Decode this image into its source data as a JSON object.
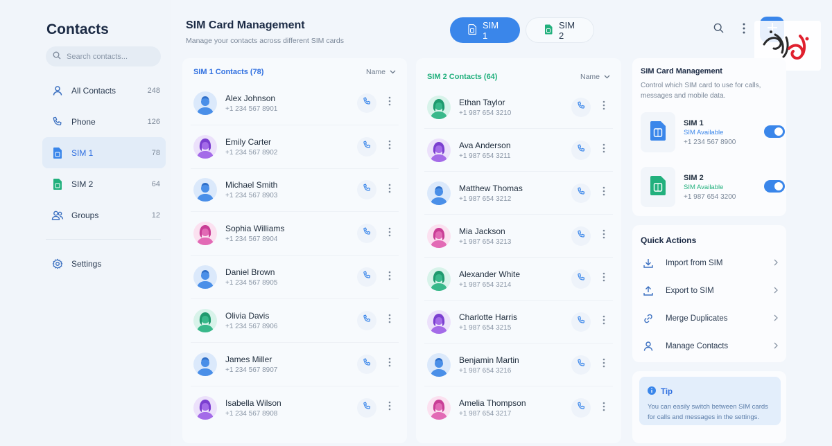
{
  "sidebar": {
    "title": "Contacts",
    "search_placeholder": "Search contacts...",
    "items": [
      {
        "label": "All Contacts",
        "count": "248"
      },
      {
        "label": "Phone",
        "count": "126"
      },
      {
        "label": "SIM 1",
        "count": "78"
      },
      {
        "label": "SIM 2",
        "count": "64"
      },
      {
        "label": "Groups",
        "count": "12"
      }
    ],
    "settings_label": "Settings"
  },
  "header": {
    "title": "SIM Card Management",
    "subtitle": "Manage your contacts across different SIM cards",
    "tabs": [
      "SIM 1",
      "SIM 2"
    ]
  },
  "sim1_panel": {
    "title": "SIM 1 Contacts (78)",
    "sort_label": "Name",
    "contacts": [
      {
        "name": "Alex Johnson",
        "phone": "+1 234 567 8901"
      },
      {
        "name": "Emily Carter",
        "phone": "+1 234 567 8902"
      },
      {
        "name": "Michael Smith",
        "phone": "+1 234 567 8903"
      },
      {
        "name": "Sophia Williams",
        "phone": "+1 234 567 8904"
      },
      {
        "name": "Daniel Brown",
        "phone": "+1 234 567 8905"
      },
      {
        "name": "Olivia Davis",
        "phone": "+1 234 567 8906"
      },
      {
        "name": "James Miller",
        "phone": "+1 234 567 8907"
      },
      {
        "name": "Isabella Wilson",
        "phone": "+1 234 567 8908"
      }
    ]
  },
  "sim2_panel": {
    "title": "SIM 2 Contacts (64)",
    "sort_label": "Name",
    "contacts": [
      {
        "name": "Ethan Taylor",
        "phone": "+1 987 654 3210"
      },
      {
        "name": "Ava Anderson",
        "phone": "+1 987 654 3211"
      },
      {
        "name": "Matthew Thomas",
        "phone": "+1 987 654 3212"
      },
      {
        "name": "Mia Jackson",
        "phone": "+1 987 654 3213"
      },
      {
        "name": "Alexander White",
        "phone": "+1 987 654 3214"
      },
      {
        "name": "Charlotte Harris",
        "phone": "+1 987 654 3215"
      },
      {
        "name": "Benjamin Martin",
        "phone": "+1 987 654 3216"
      },
      {
        "name": "Amelia Thompson",
        "phone": "+1 987 654 3217"
      }
    ]
  },
  "sim_management": {
    "title": "SIM Card Management",
    "description": "Control which SIM card to use for calls, messages and mobile data.",
    "cards": [
      {
        "name": "SIM 1",
        "status": "SIM Available",
        "number": "+1 234 567 8900",
        "enabled": true
      },
      {
        "name": "SIM 2",
        "status": "SIM Available",
        "number": "+1 987 654 3200",
        "enabled": true
      }
    ]
  },
  "quick_actions": {
    "title": "Quick Actions",
    "items": [
      {
        "label": "Import from SIM"
      },
      {
        "label": "Export to SIM"
      },
      {
        "label": "Merge Duplicates"
      },
      {
        "label": "Manage Contacts"
      }
    ]
  },
  "tip": {
    "title": "Tip",
    "text": "You can easily switch between SIM cards for calls and messages in the settings."
  },
  "colors": {
    "accent": "#3a86ea",
    "sim1": "#3a86ea",
    "sim2": "#22b07d",
    "background": "#f2f6fb"
  }
}
